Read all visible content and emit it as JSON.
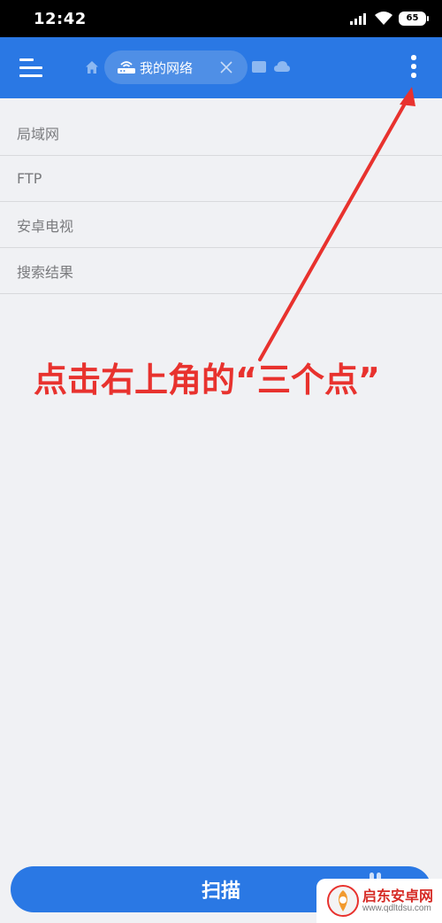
{
  "status_bar": {
    "time": "12:42",
    "battery": "65",
    "icons": [
      "signal-icon",
      "wifi-icon",
      "battery-icon"
    ]
  },
  "app_bar": {
    "menu_icon": "menu-icon",
    "home_icon": "home-icon",
    "tab": {
      "label": "我的网络",
      "icon": "router-icon",
      "close_icon": "close-icon"
    },
    "extra_icons": [
      "tablet-icon",
      "cloud-icon"
    ],
    "overflow_icon": "overflow-menu-icon",
    "color": "#2a78e4"
  },
  "list": {
    "items": [
      {
        "label": "局域网"
      },
      {
        "label": "FTP"
      },
      {
        "label": "安卓电视"
      },
      {
        "label": "搜索结果"
      }
    ]
  },
  "annotation": {
    "text": "点击右上角的“三个点”",
    "color": "#e8322e"
  },
  "bottom": {
    "scan_label": "扫描"
  },
  "watermark": {
    "title": "启东安卓网",
    "url": "www.qdltdsu.com"
  }
}
